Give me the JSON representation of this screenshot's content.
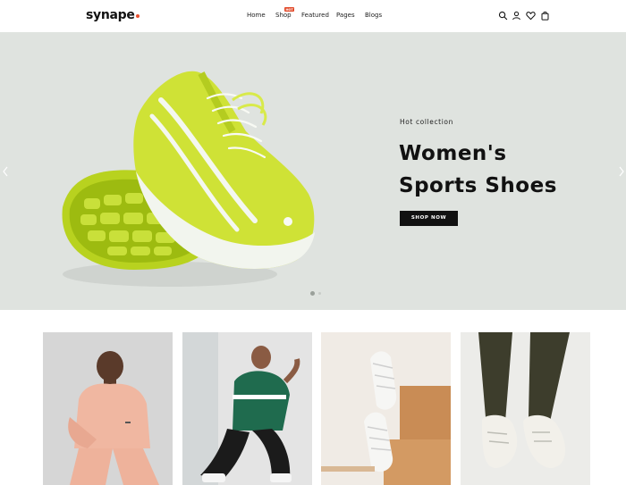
{
  "brand": {
    "name": "synape"
  },
  "nav": {
    "home": "Home",
    "shop": "Shop",
    "shop_badge": "HOT",
    "featured": "Featured",
    "pages": "Pages",
    "blogs": "Blogs"
  },
  "header_icons": [
    "search-icon",
    "user-icon",
    "heart-icon",
    "cart-icon"
  ],
  "hero": {
    "subtitle": "Hot collection",
    "title_line1": "Women's",
    "title_line2": "Sports Shoes",
    "button": "SHOP NOW",
    "slides_total": 2,
    "active_slide": 1
  },
  "colors": {
    "accent": "#e8502f",
    "hero_bg": "#dfe3df",
    "shoe": "#c6dc2a",
    "button_bg": "#111111"
  },
  "products": [
    {
      "image": "woman-in-pink-tracksuit"
    },
    {
      "image": "man-in-green-tee-crouching"
    },
    {
      "image": "white-sneakers-on-bench"
    },
    {
      "image": "white-sneakers-olive-pants"
    }
  ]
}
